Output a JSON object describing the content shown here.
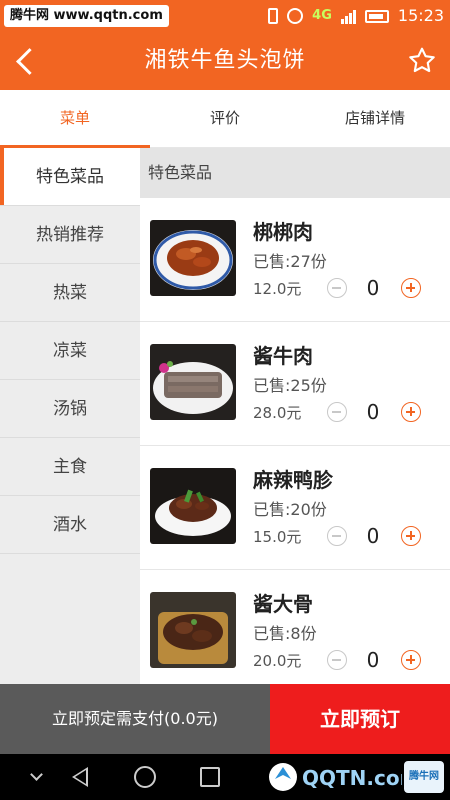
{
  "status_bar": {
    "watermark": "腾牛网 www.qqtn.com",
    "network": "4G",
    "time": "15:23"
  },
  "header": {
    "title": "湘铁牛鱼头泡饼"
  },
  "tabs": [
    {
      "label": "菜单",
      "active": true
    },
    {
      "label": "评价",
      "active": false
    },
    {
      "label": "店铺详情",
      "active": false
    }
  ],
  "categories": [
    {
      "label": "特色菜品",
      "active": true
    },
    {
      "label": "热销推荐",
      "active": false
    },
    {
      "label": "热菜",
      "active": false
    },
    {
      "label": "凉菜",
      "active": false
    },
    {
      "label": "汤锅",
      "active": false
    },
    {
      "label": "主食",
      "active": false
    },
    {
      "label": "酒水",
      "active": false
    }
  ],
  "section": {
    "title": "特色菜品"
  },
  "items": [
    {
      "name": "梆梆肉",
      "sold": "已售:27份",
      "price": "12.0元",
      "qty": "0"
    },
    {
      "name": "酱牛肉",
      "sold": "已售:25份",
      "price": "28.0元",
      "qty": "0"
    },
    {
      "name": "麻辣鸭胗",
      "sold": "已售:20份",
      "price": "15.0元",
      "qty": "0"
    },
    {
      "name": "酱大骨",
      "sold": "已售:8份",
      "price": "20.0元",
      "qty": "0"
    }
  ],
  "bottom_bar": {
    "pay_text": "立即预定需支付(0.0元)",
    "order_button": "立即预订"
  },
  "watermark_bottom": {
    "logo_text": "QQTN.com",
    "label": "腾牛网"
  },
  "colors": {
    "accent": "#f26522",
    "order_red": "#ee1d1d",
    "pay_gray": "#5a5a5a"
  }
}
